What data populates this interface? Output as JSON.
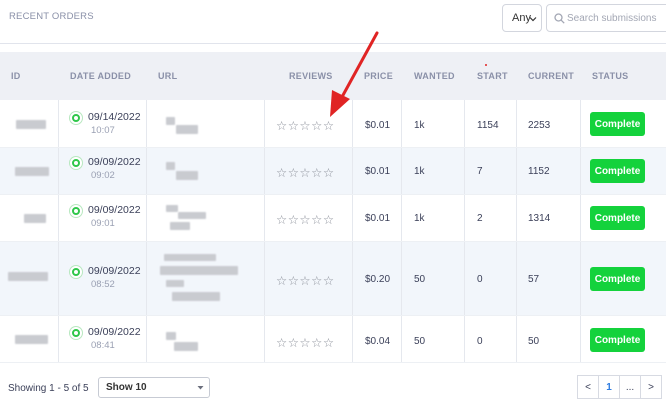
{
  "header": {
    "title": "RECENT ORDERS",
    "filter_value": "Any",
    "search_placeholder": "Search submissions"
  },
  "table": {
    "columns": {
      "id": "ID",
      "date_added": "DATE ADDED",
      "url": "URL",
      "reviews": "REVIEWS",
      "price": "PRICE",
      "wanted": "WANTED",
      "start": "START",
      "current": "CURRENT",
      "status": "STATUS"
    },
    "rows": [
      {
        "date": "09/14/2022",
        "time": "10:07",
        "stars": "☆☆☆☆☆",
        "price": "$0.01",
        "wanted": "1k",
        "start": "1154",
        "current": "2253",
        "status": "Complete"
      },
      {
        "date": "09/09/2022",
        "time": "09:02",
        "stars": "☆☆☆☆☆",
        "price": "$0.01",
        "wanted": "1k",
        "start": "7",
        "current": "1152",
        "status": "Complete"
      },
      {
        "date": "09/09/2022",
        "time": "09:01",
        "stars": "☆☆☆☆☆",
        "price": "$0.01",
        "wanted": "1k",
        "start": "2",
        "current": "1314",
        "status": "Complete"
      },
      {
        "date": "09/09/2022",
        "time": "08:52",
        "stars": "☆☆☆☆☆",
        "price": "$0.20",
        "wanted": "50",
        "start": "0",
        "current": "57",
        "status": "Complete"
      },
      {
        "date": "09/09/2022",
        "time": "08:41",
        "stars": "☆☆☆☆☆",
        "price": "$0.04",
        "wanted": "50",
        "start": "0",
        "current": "50",
        "status": "Complete"
      }
    ]
  },
  "footer": {
    "showing": "Showing 1 - 5 of 5",
    "page_size": "Show 10",
    "pager": {
      "prev": "<",
      "current": "1",
      "ellipsis": "...",
      "next": ">"
    }
  },
  "colors": {
    "status_complete": "#14d23c",
    "status_dot": "#2fc74a",
    "annotation_arrow": "#e02424",
    "active_page": "#2f7de1"
  }
}
